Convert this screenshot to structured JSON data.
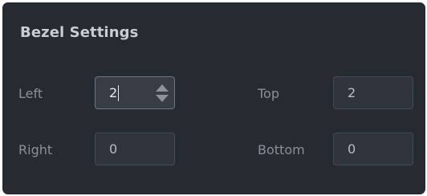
{
  "panel": {
    "title": "Bezel Settings"
  },
  "fields": {
    "left": {
      "label": "Left",
      "value": "2"
    },
    "top": {
      "label": "Top",
      "value": "2"
    },
    "right": {
      "label": "Right",
      "value": "0"
    },
    "bottom": {
      "label": "Bottom",
      "value": "0"
    }
  },
  "icons": {
    "spinner_up": "chevron-up-icon",
    "spinner_down": "chevron-down-icon"
  },
  "colors": {
    "panel_bg": "#262a31",
    "field_bg": "#30353d",
    "field_border": "#454b54",
    "focused_border": "#6f7680",
    "title_text": "#c9ccd1",
    "label_text": "#8b9098"
  }
}
